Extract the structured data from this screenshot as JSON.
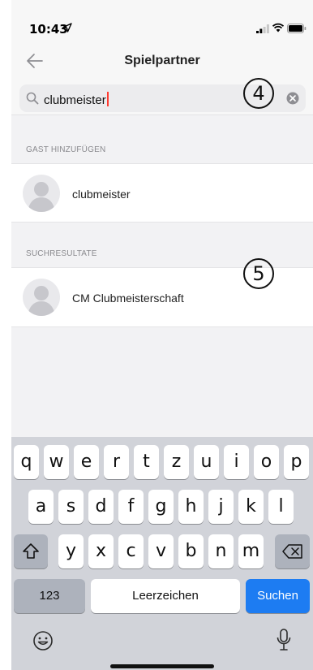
{
  "status_bar": {
    "time": "10:43"
  },
  "nav": {
    "title": "Spielpartner"
  },
  "search": {
    "query": "clubmeister"
  },
  "annotations": {
    "first": "4",
    "second": "5"
  },
  "sections": {
    "add_guest": {
      "header": "GAST HINZUFÜGEN",
      "item": "clubmeister"
    },
    "results": {
      "header": "SUCHRESULTATE",
      "item": "CM Clubmeisterschaft"
    }
  },
  "keyboard": {
    "row1": [
      "q",
      "w",
      "e",
      "r",
      "t",
      "z",
      "u",
      "i",
      "o",
      "p"
    ],
    "row2": [
      "a",
      "s",
      "d",
      "f",
      "g",
      "h",
      "j",
      "k",
      "l"
    ],
    "row3": [
      "y",
      "x",
      "c",
      "v",
      "b",
      "n",
      "m"
    ],
    "numbers_label": "123",
    "space_label": "Leerzeichen",
    "search_label": "Suchen",
    "icons": [
      "shift-icon",
      "backspace-icon",
      "emoji-icon",
      "microphone-icon"
    ],
    "accent_color": "#1d7cf2"
  }
}
